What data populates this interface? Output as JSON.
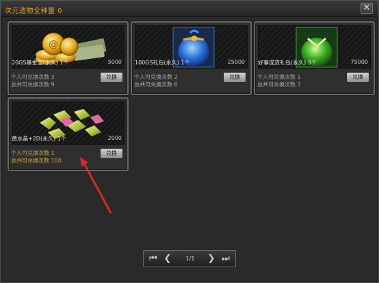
{
  "window": {
    "title": "次元遗物全种量 0",
    "close_icon": "close-x-icon"
  },
  "cards": [
    {
      "name": "20GS基金宝(永久) 1个",
      "price": "5000",
      "line1": "个人可兑换次数 3",
      "line2": "总共可兑换次数 9",
      "button": "兑换",
      "image": "gold-coins-money-icon"
    },
    {
      "name": "100GS礼包(永久) 1个",
      "price": "25000",
      "line1": "个人可兑换次数 2",
      "line2": "总共可兑换次数 6",
      "button": "兑换",
      "image": "blue-pouch-icon"
    },
    {
      "name": "好事成双礼包(永久) 3个",
      "price": "75000",
      "line1": "个人可兑换次数 1",
      "line2": "总共可兑换次数 3",
      "button": "兑换",
      "image": "green-pouch-icon"
    },
    {
      "name": "黄水晶+2D(永久) 1个",
      "price": "2000",
      "line1": "个人可兑换次数 1",
      "line2": "总共可兑换次数 100",
      "button": "兑换",
      "image": "yellow-crystals-icon"
    }
  ],
  "pager": {
    "page_text": "1/1",
    "first_icon": "first-page-icon",
    "prev_icon": "prev-page-icon",
    "next_icon": "next-page-icon",
    "last_icon": "last-page-icon"
  },
  "colors": {
    "title": "#e0a028",
    "highlight_text": "#c9a848",
    "annotation_arrow": "#d42b2b"
  }
}
